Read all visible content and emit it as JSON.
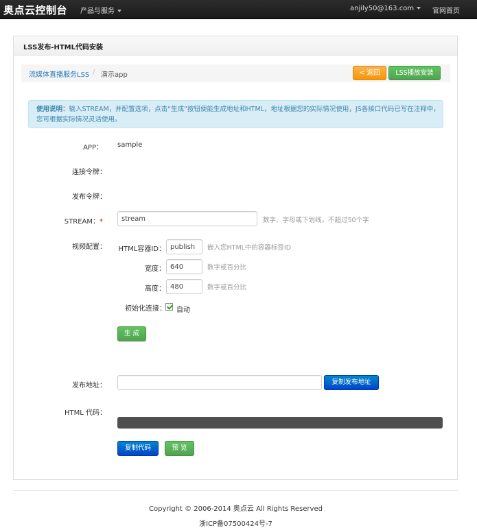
{
  "topbar": {
    "brand": "奥点云控制台",
    "products_menu": "产品与服务",
    "user": "anjily50@163.com",
    "home_link": "官网首页"
  },
  "panel": {
    "title": "LSS发布-HTML代码安装"
  },
  "breadcrumb": {
    "parent": "流媒体直播服务LSS",
    "separator": "/",
    "current": "演示app"
  },
  "actions": {
    "back": "< 返回",
    "play_install": "LSS播放安装"
  },
  "info": {
    "title": "使用说明：",
    "text": "输入STREAM，并配置选项，点击“生成”按钮便能生成地址和HTML，地址根据您的实际情况使用，JS各接口代码已写在注释中，您可根据实际情况灵活使用。"
  },
  "form": {
    "app_label": "APP：",
    "app_value": "sample",
    "connect_token_label": "连接令牌：",
    "publish_token_label": "发布令牌：",
    "stream_label": "STREAM：",
    "stream_required": "*",
    "stream_value": "stream",
    "stream_hint": "数字、字母或下划线，不超过50个字",
    "video_config_label": "视频配置：",
    "container_id_label": "HTML容器ID：",
    "container_id_value": "publish",
    "container_id_hint": "嵌入您HTML中的容器标签ID",
    "width_label": "宽度：",
    "width_value": "640",
    "width_hint": "数字或百分比",
    "height_label": "高度：",
    "height_value": "480",
    "height_hint": "数字或百分比",
    "init_connect_label": "初始化连接：",
    "auto_label": "自动",
    "auto_checked": true,
    "generate_button": "生 成",
    "publish_addr_label": "发布地址：",
    "publish_addr_value": "",
    "copy_addr_button": "复制发布地址",
    "html_code_label": "HTML 代码：",
    "copy_code_button": "复制代码",
    "preview_button": "预 览"
  },
  "footer": {
    "copyright": "Copyright © 2006-2014 奥点云 All Rights Reserved",
    "icp": "浙ICP备07500424号-7"
  }
}
